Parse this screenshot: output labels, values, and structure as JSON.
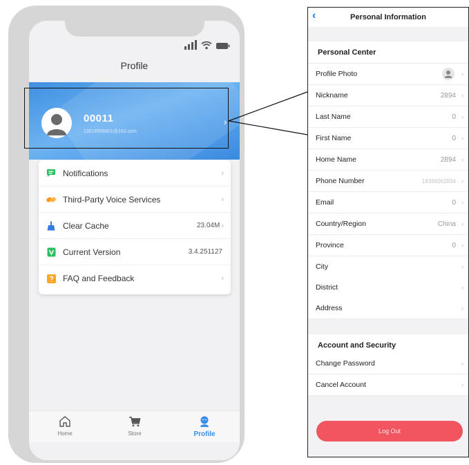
{
  "phone": {
    "title": "Profile",
    "user": {
      "name": "00011",
      "email": "13516956801@163.com"
    },
    "menu": [
      {
        "label": "Notifications",
        "value": "",
        "icon": "notification-icon",
        "color": "#2dbe60"
      },
      {
        "label": "Third-Party Voice Services",
        "value": "",
        "icon": "voice-services-icon",
        "color": "#ff9a1f"
      },
      {
        "label": "Clear Cache",
        "value": "23.04M",
        "icon": "broom-icon",
        "color": "#2f7be0"
      },
      {
        "label": "Current Version",
        "value": "3.4.251127",
        "icon": "version-icon",
        "color": "#2dbe60"
      },
      {
        "label": "FAQ and Feedback",
        "value": "",
        "icon": "help-icon",
        "color": "#ffa526"
      }
    ],
    "tabs": [
      {
        "label": "Home",
        "icon": "home-icon"
      },
      {
        "label": "Store",
        "icon": "cart-icon"
      },
      {
        "label": "Profile",
        "icon": "profile-icon",
        "active": true
      }
    ],
    "accent": "#3a8ee6"
  },
  "panel": {
    "title": "Personal Information",
    "personal_center": {
      "header": "Personal Center",
      "profile_photo_label": "Profile Photo",
      "rows": [
        {
          "label": "Nickname",
          "value": "2894"
        },
        {
          "label": "Last Name",
          "value": "0"
        },
        {
          "label": "First Name",
          "value": "0"
        },
        {
          "label": "Home Name",
          "value": "2894"
        },
        {
          "label": "Phone Number",
          "value": "18356062894"
        },
        {
          "label": "Email",
          "value": "0"
        },
        {
          "label": "Country/Region",
          "value": "China"
        },
        {
          "label": "Province",
          "value": "0"
        },
        {
          "label": "City",
          "value": ""
        },
        {
          "label": "District",
          "value": ""
        },
        {
          "label": "Address",
          "value": ""
        }
      ]
    },
    "account_security": {
      "header": "Account and Security",
      "rows": [
        {
          "label": "Change Password"
        },
        {
          "label": "Cancel Account"
        }
      ]
    },
    "logout_label": "Log Out",
    "logout_color": "#f05560"
  }
}
